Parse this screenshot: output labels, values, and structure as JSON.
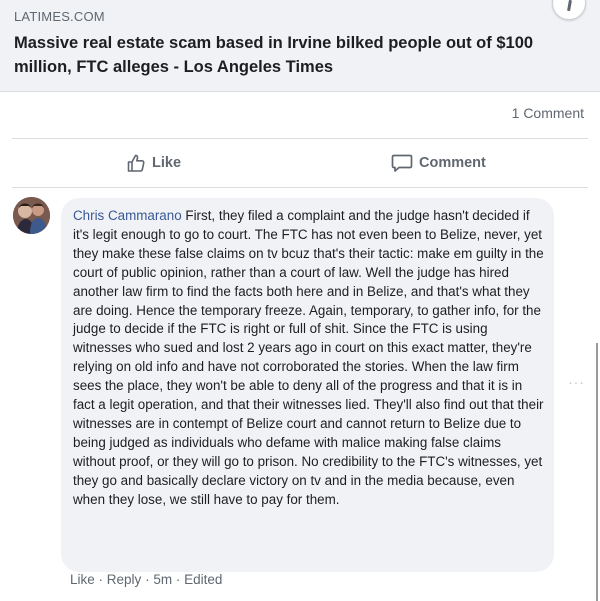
{
  "link_preview": {
    "source": "LATIMES.COM",
    "title": "Massive real estate scam based in Irvine bilked people out of $100 million, FTC alleges - Los Angeles Times"
  },
  "stats": {
    "comment_count": "1 Comment"
  },
  "actions": {
    "like": "Like",
    "comment": "Comment"
  },
  "comment": {
    "author": "Chris Cammarano",
    "text": "First, they filed a complaint and the judge hasn't decided if it's legit enough to go to court. The FTC has not even been to Belize, never, yet they make these false claims on tv bcuz that's their tactic: make em guilty in the court of public opinion, rather than a court of law. Well the judge has hired another law firm to find the facts both here and in Belize, and that's what they are doing. Hence the temporary freeze. Again, temporary, to gather info, for the judge to decide if the FTC is right or full of shit. Since the FTC is using witnesses who sued and lost 2 years ago in court on this exact matter, they're relying on old info and have not corroborated the stories. When the law firm sees the place, they won't be able to deny all of the progress and that it is in fact a legit operation, and that their witnesses lied. They'll also find out that their witnesses are in contempt of Belize court and cannot return to Belize due to being judged as individuals who defame with malice making false claims without proof, or they will go to prison. No credibility to the FTC's witnesses, yet they go and basically declare victory on tv and in the media because, even when they lose, we still have to pay for them.",
    "like": "Like",
    "reply": "Reply",
    "time": "5m",
    "edited": "Edited",
    "separator": "·"
  },
  "more_options": "···",
  "colors": {
    "bubble": "#f0f2f5",
    "muted_text": "#606770",
    "author_link": "#385898"
  },
  "icons": {
    "like": "thumbs-up-icon",
    "comment": "speech-bubble-icon",
    "more": "more-options-icon"
  }
}
